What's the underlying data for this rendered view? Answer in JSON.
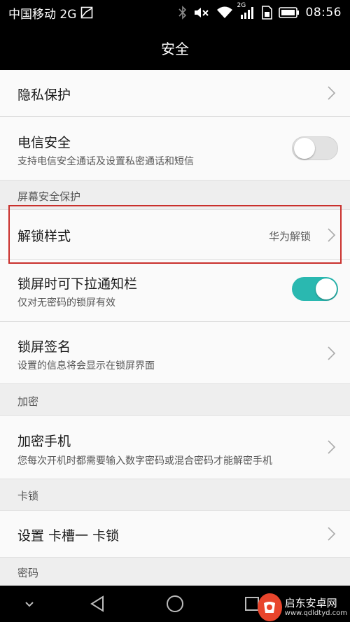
{
  "status_bar": {
    "carrier": "中国移动 2G",
    "network_badge": "2G",
    "time": "08:56",
    "icons": [
      "image-icon",
      "bluetooth-icon",
      "mute-icon",
      "wifi-icon",
      "signal-icon",
      "sim-icon",
      "battery-icon"
    ]
  },
  "header": {
    "title": "安全"
  },
  "items": {
    "privacy": {
      "label": "隐私保护"
    },
    "telecom": {
      "label": "电信安全",
      "sub": "支持电信安全通话及设置私密通话和短信",
      "toggle": false
    },
    "unlock_style": {
      "label": "解锁样式",
      "value": "华为解锁"
    },
    "pulldown": {
      "label": "锁屏时可下拉通知栏",
      "sub": "仅对无密码的锁屏有效",
      "toggle": true
    },
    "signature": {
      "label": "锁屏签名",
      "sub": "设置的信息将会显示在锁屏界面"
    },
    "encrypt_phone": {
      "label": "加密手机",
      "sub": "您每次开机时都需要输入数字密码或混合密码才能解密手机"
    },
    "sim_lock": {
      "label": "设置 卡槽一 卡锁"
    }
  },
  "sections": {
    "screen_security": "屏幕安全保护",
    "encryption": "加密",
    "card_lock": "卡锁",
    "password": "密码"
  },
  "nav": {
    "icons": [
      "chevron-down-icon",
      "back-icon",
      "home-icon",
      "recents-icon"
    ]
  },
  "watermark": {
    "brand": "启东安卓网",
    "url": "www.qdldtyd.com"
  },
  "colors": {
    "accent": "#2ab8b0",
    "highlight": "#c9302c",
    "bar": "#000000"
  }
}
